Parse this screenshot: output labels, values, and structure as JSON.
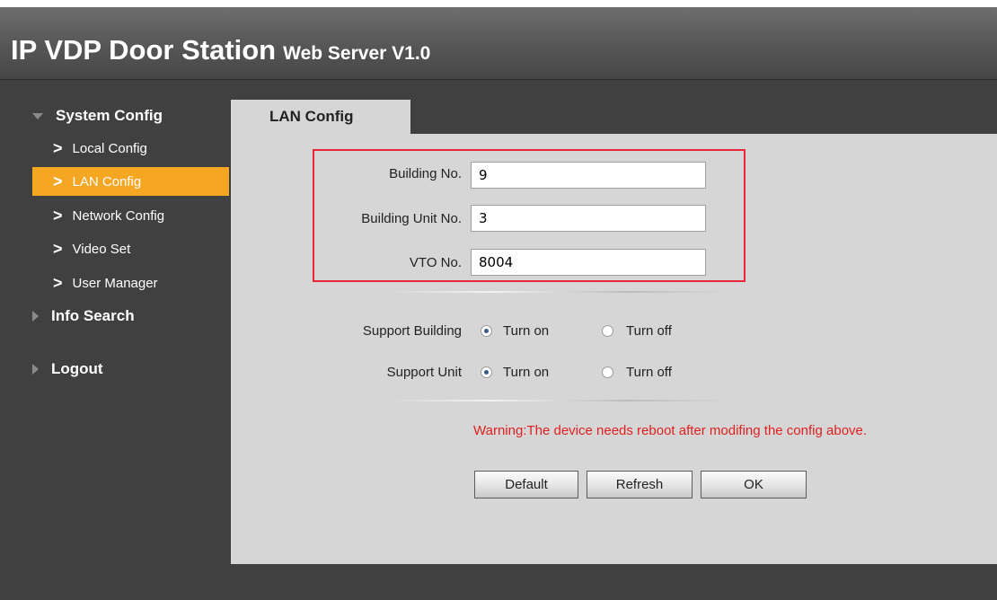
{
  "header": {
    "title": "IP VDP Door Station",
    "subtitle": "Web Server V1.0"
  },
  "sidebar": {
    "system_config": "System Config",
    "items": [
      {
        "label": "Local Config"
      },
      {
        "label": "LAN Config"
      },
      {
        "label": "Network Config"
      },
      {
        "label": "Video Set"
      },
      {
        "label": "User Manager"
      }
    ],
    "active_item": "LAN Config",
    "info_search": "Info Search",
    "logout": "Logout"
  },
  "tab": {
    "label": "LAN Config"
  },
  "form": {
    "building_no": {
      "label": "Building No.",
      "value": "9"
    },
    "building_unit_no": {
      "label": "Building Unit No.",
      "value": "3"
    },
    "vto_no": {
      "label": "VTO No.",
      "value": "8004"
    },
    "support_building": {
      "label": "Support Building",
      "on_label": "Turn on",
      "off_label": "Turn off",
      "selected": "Turn on"
    },
    "support_unit": {
      "label": "Support Unit",
      "on_label": "Turn on",
      "off_label": "Turn off",
      "selected": "Turn on"
    },
    "warning": "Warning:The device needs reboot after modifing the config above."
  },
  "buttons": {
    "default": "Default",
    "refresh": "Refresh",
    "ok": "OK"
  },
  "icons": {
    "expanded": "triangle-down-icon",
    "collapsed": "triangle-right-icon",
    "item": "chevron-right-icon"
  },
  "colors": {
    "active_nav": "#f5a623",
    "highlight_border": "#e8283a",
    "warning_text": "#e02020",
    "panel_bg": "#d6d6d6",
    "dark_bg": "#404040"
  }
}
